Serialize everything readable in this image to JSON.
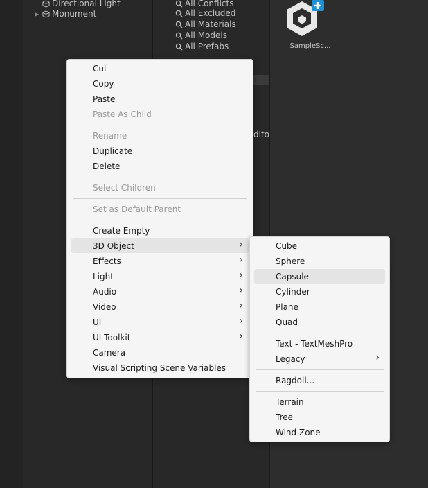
{
  "hierarchy": {
    "items": [
      {
        "label": "Directional Light",
        "icon": "gameobject-cube-icon"
      },
      {
        "label": "Monument",
        "icon": "gameobject-cube-icon",
        "has_foldout": true
      }
    ]
  },
  "project": {
    "search_filters": [
      {
        "label": "All Conflicts"
      },
      {
        "label": "All Excluded"
      },
      {
        "label": "All Materials"
      },
      {
        "label": "All Models"
      },
      {
        "label": "All Prefabs"
      }
    ],
    "partial_text": "ditor",
    "asset": {
      "label": "SampleSc...",
      "icon": "unity-scene-icon"
    }
  },
  "context_menu": {
    "items": [
      {
        "label": "Cut"
      },
      {
        "label": "Copy"
      },
      {
        "label": "Paste"
      },
      {
        "label": "Paste As Child",
        "disabled": true
      },
      {
        "label": "Rename",
        "disabled": true
      },
      {
        "label": "Duplicate"
      },
      {
        "label": "Delete"
      },
      {
        "label": "Select Children",
        "disabled": true
      },
      {
        "label": "Set as Default Parent",
        "disabled": true
      },
      {
        "label": "Create Empty"
      },
      {
        "label": "3D Object",
        "submenu": true,
        "highlighted": true
      },
      {
        "label": "Effects",
        "submenu": true
      },
      {
        "label": "Light",
        "submenu": true
      },
      {
        "label": "Audio",
        "submenu": true
      },
      {
        "label": "Video",
        "submenu": true
      },
      {
        "label": "UI",
        "submenu": true
      },
      {
        "label": "UI Toolkit",
        "submenu": true
      },
      {
        "label": "Camera"
      },
      {
        "label": "Visual Scripting Scene Variables"
      }
    ]
  },
  "submenu_3d_object": {
    "items": [
      {
        "label": "Cube"
      },
      {
        "label": "Sphere"
      },
      {
        "label": "Capsule",
        "highlighted": true
      },
      {
        "label": "Cylinder"
      },
      {
        "label": "Plane"
      },
      {
        "label": "Quad"
      },
      {
        "label": "Text - TextMeshPro"
      },
      {
        "label": "Legacy",
        "submenu": true
      },
      {
        "label": "Ragdoll..."
      },
      {
        "label": "Terrain"
      },
      {
        "label": "Tree"
      },
      {
        "label": "Wind Zone"
      }
    ]
  },
  "colors": {
    "menu_bg": "#f5f5f5",
    "menu_highlight": "#e4e4e4",
    "editor_bg": "#282828",
    "scene_badge": "#1e90d6"
  }
}
